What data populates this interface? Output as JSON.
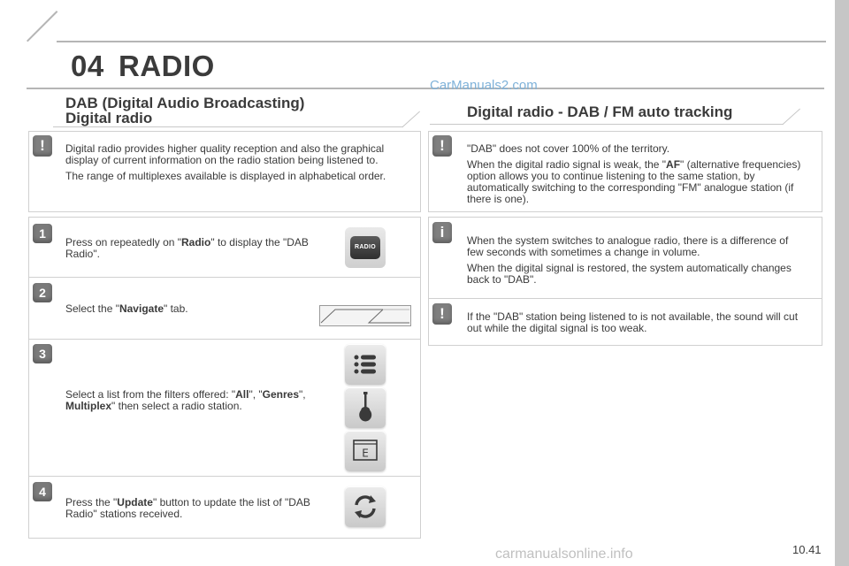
{
  "header": {
    "chapter_number": "04",
    "chapter_title": "RADIO"
  },
  "watermark": "CarManuals2.com",
  "footer": {
    "watermark": "carmanualsonline.info",
    "page_number": "10.41"
  },
  "left": {
    "title_line1": "DAB (Digital Audio Broadcasting)",
    "title_line2": "Digital radio",
    "info": {
      "badge": "!",
      "p1": "Digital radio provides higher quality reception and also the graphical display of current information on the radio station being listened to.",
      "p2": "The range of multiplexes available is displayed in alphabetical order."
    },
    "steps": [
      {
        "number": "1",
        "pre": "Press on repeatedly on \"",
        "bold": "Radio",
        "post": "\" to display the \"DAB Radio\".",
        "button_label": "RADIO"
      },
      {
        "number": "2",
        "pre": "Select the \"",
        "bold": "Navigate",
        "post": "\" tab."
      },
      {
        "number": "3",
        "pre": "Select a list from the filters offered: \"",
        "bold1": "All",
        "mid1": "\", \"",
        "bold2": "Genres",
        "mid2": "\", ",
        "bold3": "Multiplex",
        "post": "\" then select a radio station.",
        "filter_icon_letter": "E"
      },
      {
        "number": "4",
        "pre": "Press the \"",
        "bold": "Update",
        "post": "\" button to update the list of \"DAB Radio\" stations received."
      }
    ]
  },
  "right": {
    "title": "Digital radio - DAB / FM auto tracking",
    "notes": [
      {
        "badge": "!",
        "p1": "\"DAB\" does not cover 100% of the territory.",
        "p2_pre": "When the digital radio signal is weak, the \"",
        "p2_bold": "AF",
        "p2_post": "\" (alternative frequencies) option allows you to continue listening to the same station, by automatically switching to the corresponding \"FM\" analogue station (if there is one)."
      },
      {
        "badge": "i",
        "p1": "When the system switches to analogue radio, there is a difference of few seconds with sometimes a change in volume.",
        "p2": "When the digital signal is restored, the system automatically changes back to \"DAB\"."
      },
      {
        "badge": "!",
        "p1": "If the \"DAB\" station being listened to is not available, the sound will cut out while the digital signal is too weak."
      }
    ]
  }
}
